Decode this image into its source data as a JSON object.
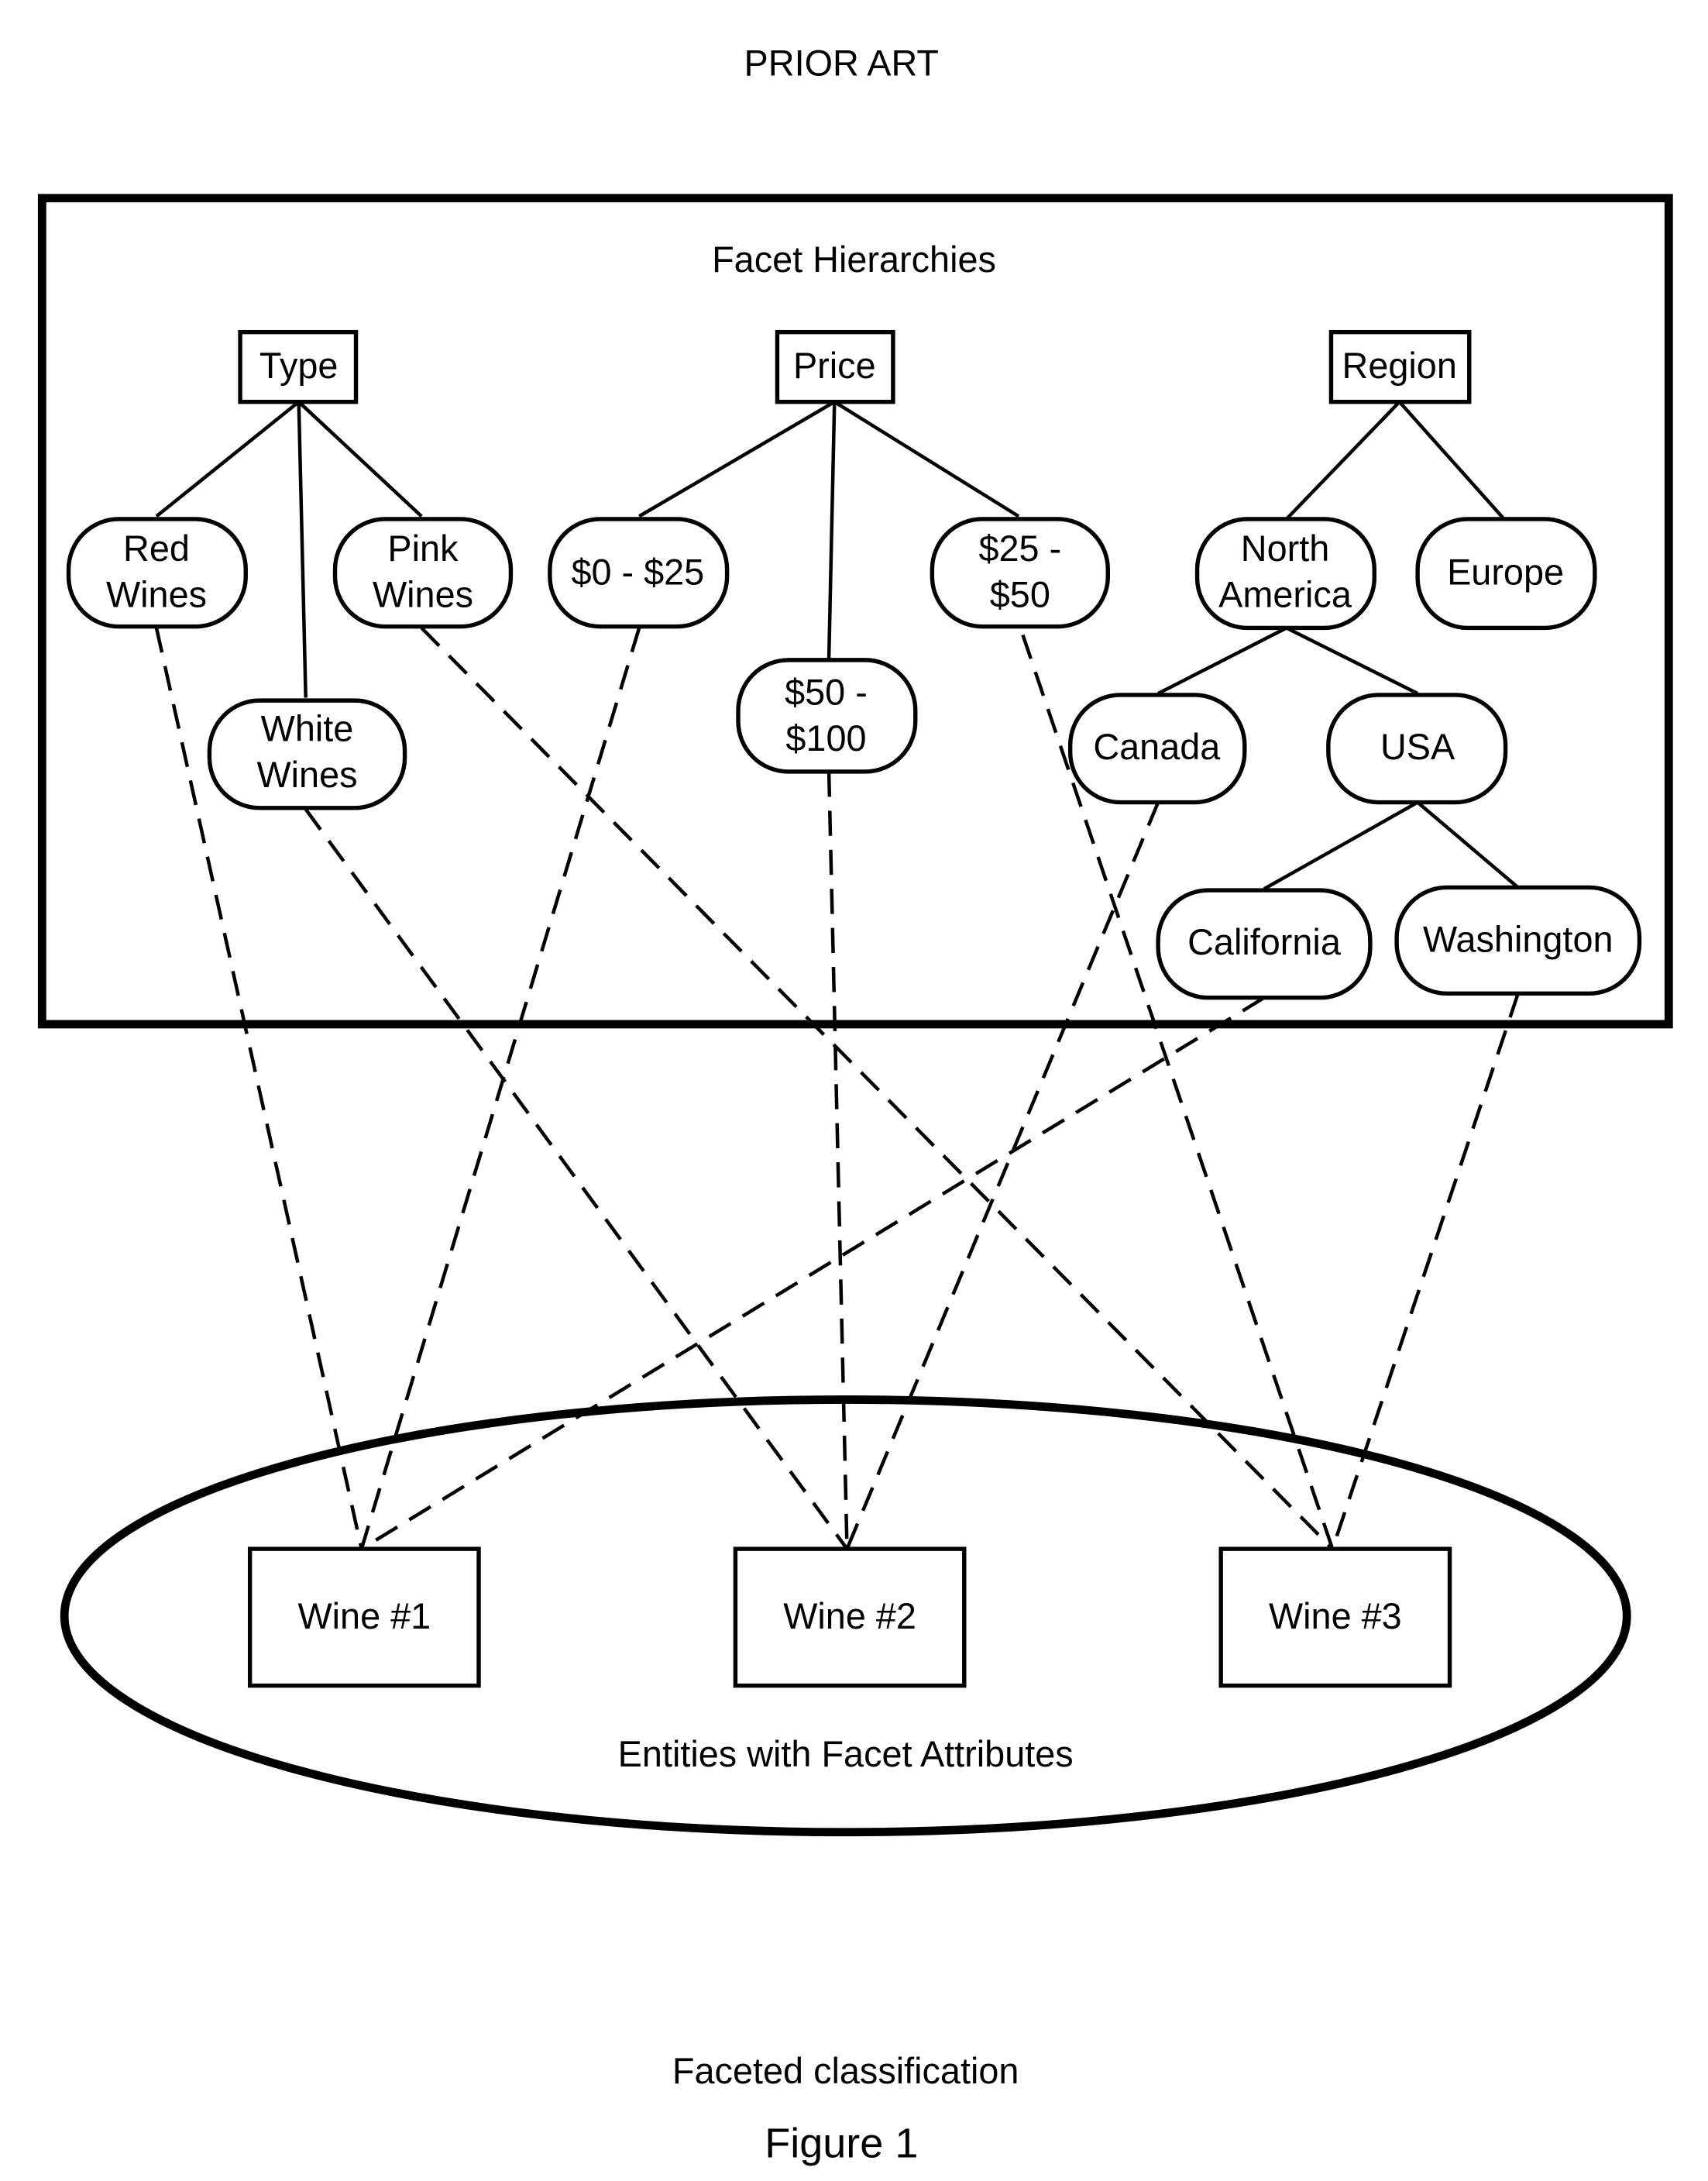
{
  "header": {
    "label": "PRIOR ART"
  },
  "facet_box": {
    "title": "Facet Hierarchies"
  },
  "roots": {
    "type": "Type",
    "price": "Price",
    "region": "Region"
  },
  "nodes": {
    "red": [
      "Red",
      "Wines"
    ],
    "white": [
      "White",
      "Wines"
    ],
    "pink": [
      "Pink",
      "Wines"
    ],
    "p0_25": [
      "$0 - $25"
    ],
    "p50_100": [
      "$50 -",
      "$100"
    ],
    "p25_50": [
      "$25 -",
      "$50"
    ],
    "north_america": [
      "North",
      "America"
    ],
    "europe": [
      "Europe"
    ],
    "canada": [
      "Canada"
    ],
    "usa": [
      "USA"
    ],
    "california": [
      "California"
    ],
    "washington": [
      "Washington"
    ]
  },
  "entities": {
    "title": "Entities with Facet Attributes",
    "wine1": "Wine #1",
    "wine2": "Wine #2",
    "wine3": "Wine #3"
  },
  "links": [
    {
      "from": "Red Wines",
      "to": "Wine #1"
    },
    {
      "from": "$0 - $25",
      "to": "Wine #1"
    },
    {
      "from": "California",
      "to": "Wine #1"
    },
    {
      "from": "White Wines",
      "to": "Wine #2"
    },
    {
      "from": "$50 - $100",
      "to": "Wine #2"
    },
    {
      "from": "Canada",
      "to": "Wine #2"
    },
    {
      "from": "Pink Wines",
      "to": "Wine #3"
    },
    {
      "from": "$25 - $50",
      "to": "Wine #3"
    },
    {
      "from": "Washington",
      "to": "Wine #3"
    }
  ],
  "caption": "Faceted classification",
  "figure_label": "Figure 1"
}
